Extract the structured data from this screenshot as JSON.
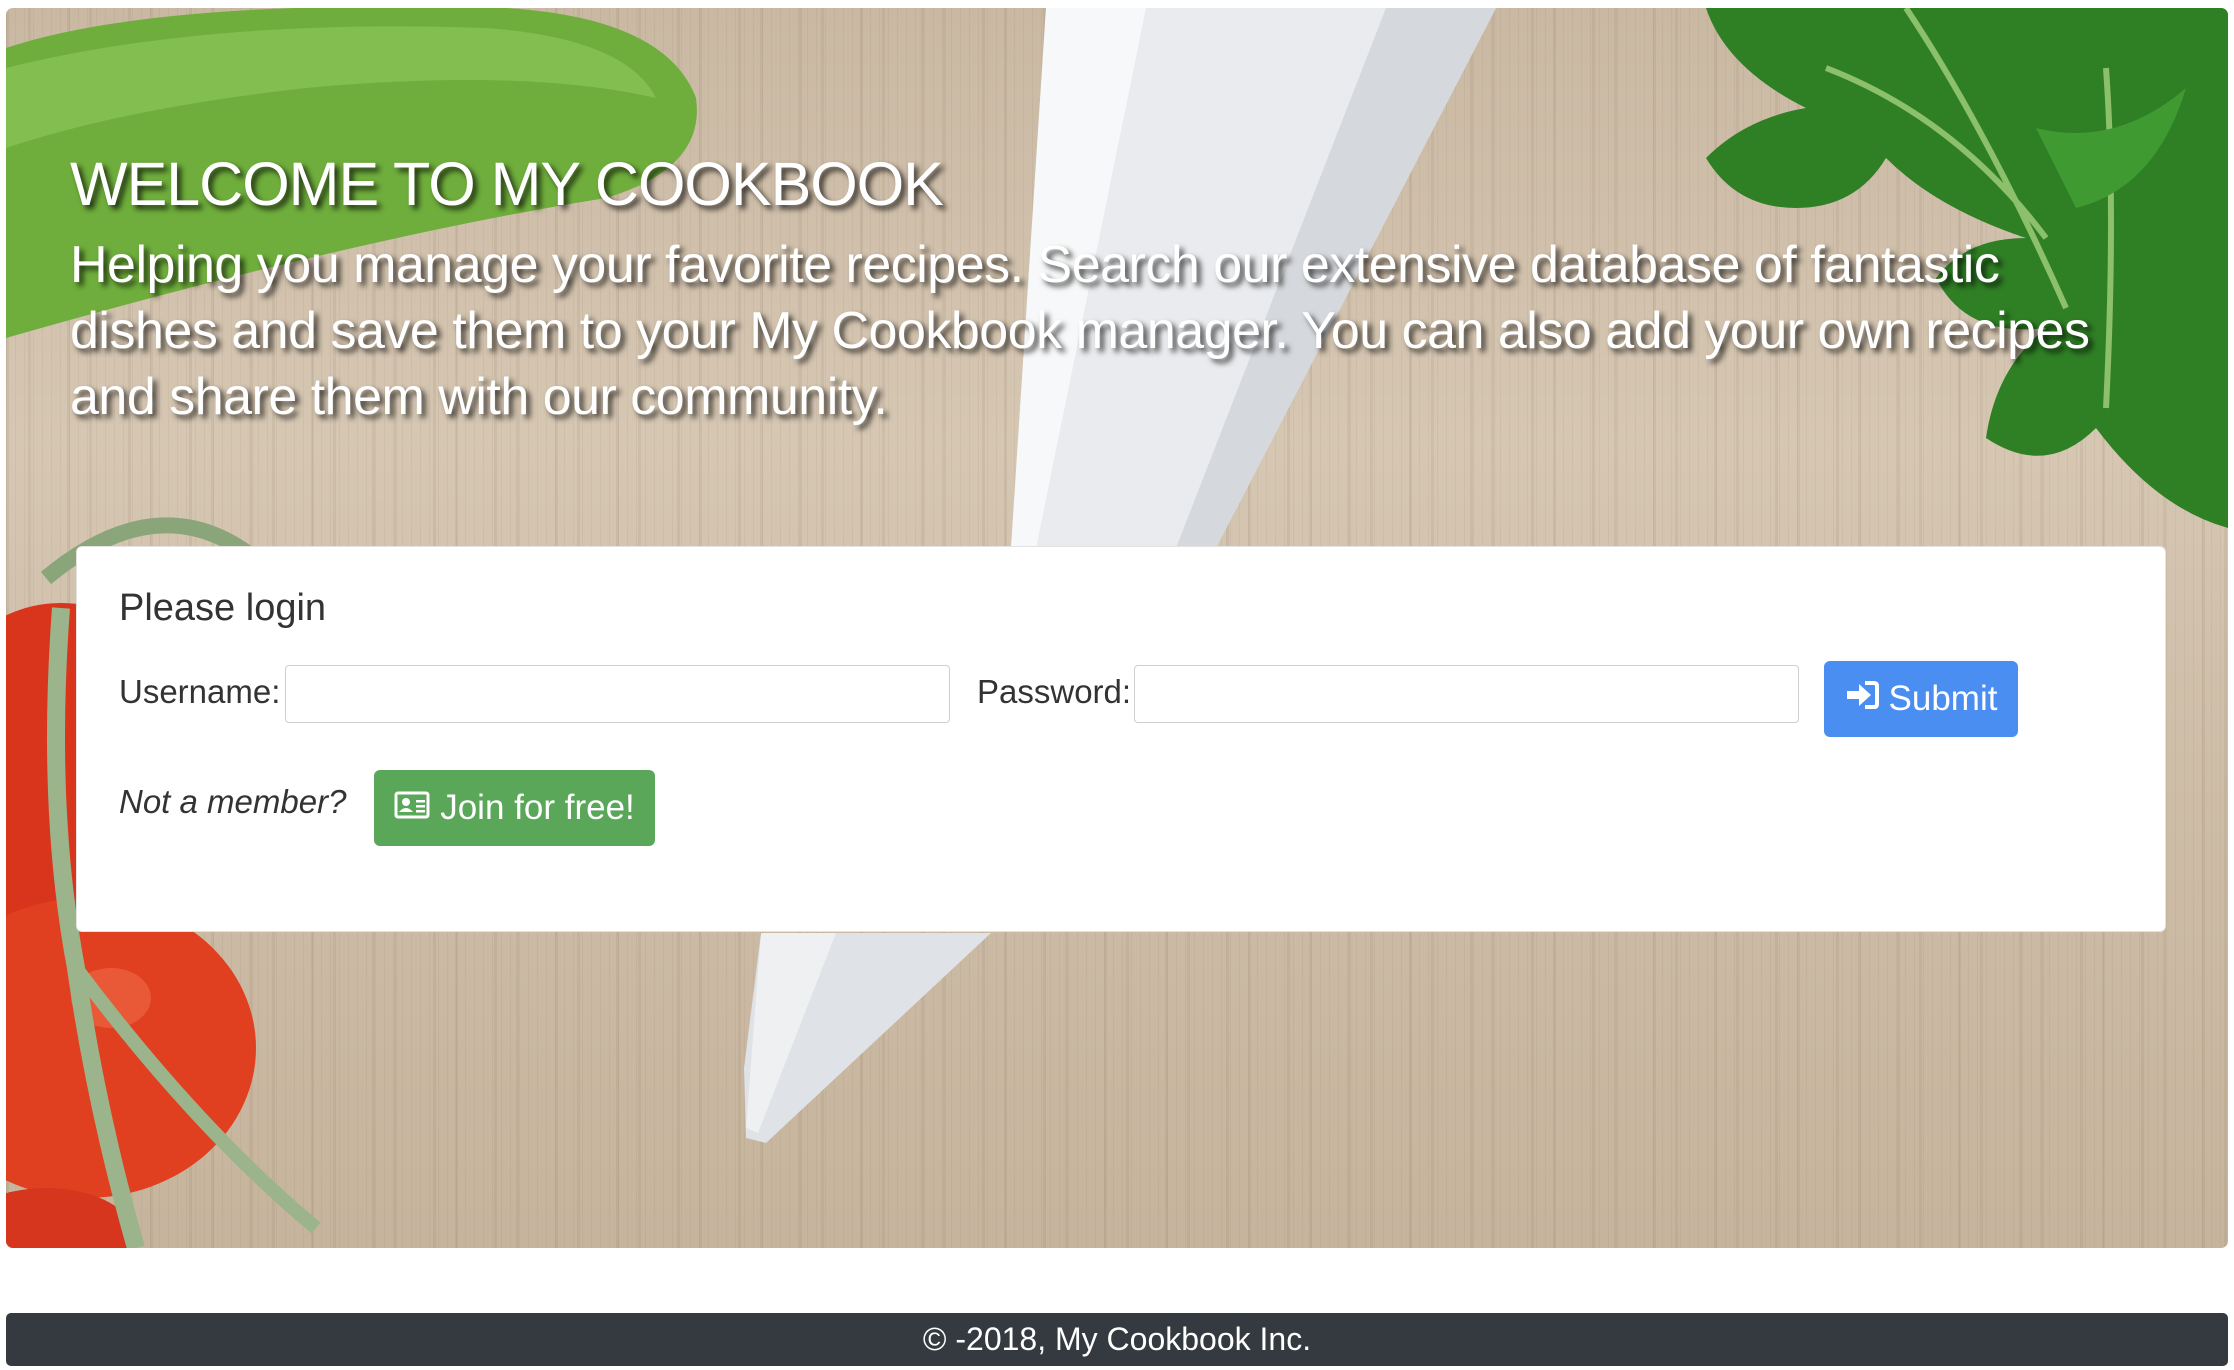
{
  "hero": {
    "title": "WELCOME TO MY COOKBOOK",
    "subtitle": "Helping you manage your favorite recipes. Search our extensive database of fantastic dishes and save them to your My Cookbook manager. You can also add your own recipes and share them with our community."
  },
  "login": {
    "heading": "Please login",
    "username_label": "Username:",
    "username_value": "",
    "password_label": "Password:",
    "password_value": "",
    "submit_label": "Submit",
    "submit_icon": "sign-in-icon",
    "not_member_text": "Not a member?",
    "join_label": "Join for free!",
    "join_icon": "id-card-icon"
  },
  "footer": {
    "text": "© -2018, My Cookbook Inc."
  },
  "colors": {
    "submit_button": "#4a8ef2",
    "join_button": "#5aa75a",
    "footer_bg": "#343a40"
  }
}
